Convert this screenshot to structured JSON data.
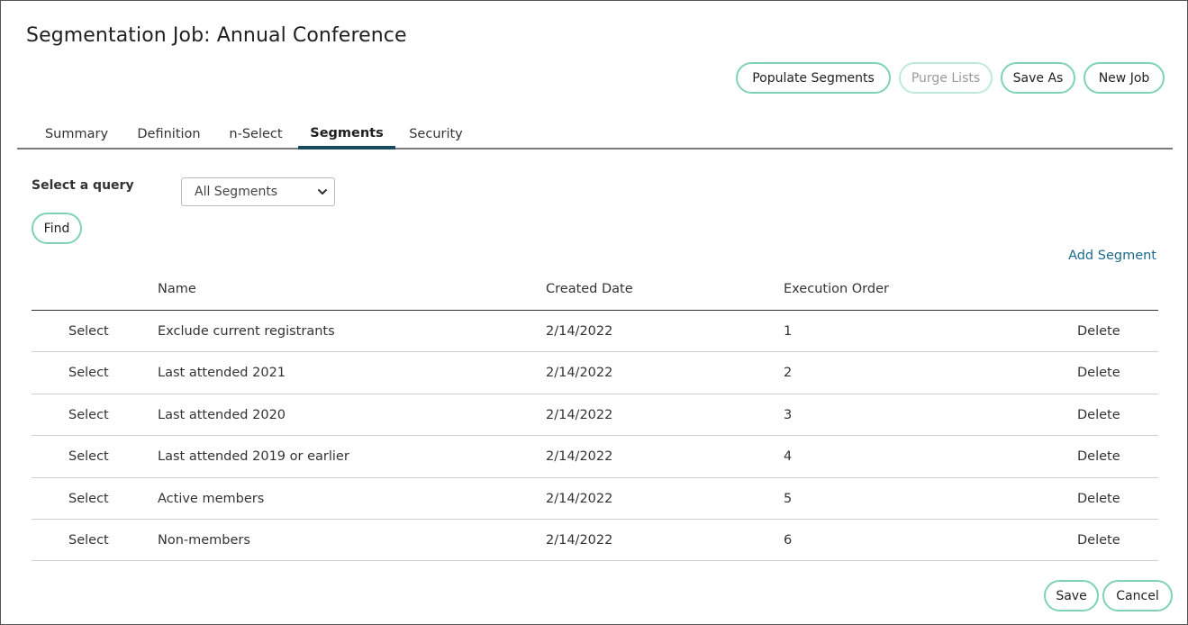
{
  "page": {
    "title": "Segmentation Job: Annual Conference"
  },
  "toolbar": {
    "populate_label": "Populate Segments",
    "purge_label": "Purge Lists",
    "save_as_label": "Save As",
    "new_job_label": "New Job"
  },
  "tabs": [
    {
      "label": "Summary",
      "active": false
    },
    {
      "label": "Definition",
      "active": false
    },
    {
      "label": "n-Select",
      "active": false
    },
    {
      "label": "Segments",
      "active": true
    },
    {
      "label": "Security",
      "active": false
    }
  ],
  "query": {
    "label": "Select a query",
    "selected": "All Segments",
    "find_label": "Find"
  },
  "add_segment_label": "Add Segment",
  "table": {
    "columns": [
      "",
      "Name",
      "Created Date",
      "Execution Order",
      ""
    ],
    "rows": [
      {
        "select": "Select",
        "name": "Exclude current registrants",
        "created": "2/14/2022",
        "order": "1",
        "delete": "Delete"
      },
      {
        "select": "Select",
        "name": "Last attended 2021",
        "created": "2/14/2022",
        "order": "2",
        "delete": "Delete"
      },
      {
        "select": "Select",
        "name": "Last attended 2020",
        "created": "2/14/2022",
        "order": "3",
        "delete": "Delete"
      },
      {
        "select": "Select",
        "name": "Last attended 2019 or earlier",
        "created": "2/14/2022",
        "order": "4",
        "delete": "Delete"
      },
      {
        "select": "Select",
        "name": "Active members",
        "created": "2/14/2022",
        "order": "5",
        "delete": "Delete"
      },
      {
        "select": "Select",
        "name": "Non-members",
        "created": "2/14/2022",
        "order": "6",
        "delete": "Delete"
      }
    ]
  },
  "footer": {
    "save_label": "Save",
    "cancel_label": "Cancel"
  },
  "colors": {
    "accent_border": "#7fd3b4",
    "link": "#1e6a8e",
    "active_tab": "#1a4a5e"
  }
}
